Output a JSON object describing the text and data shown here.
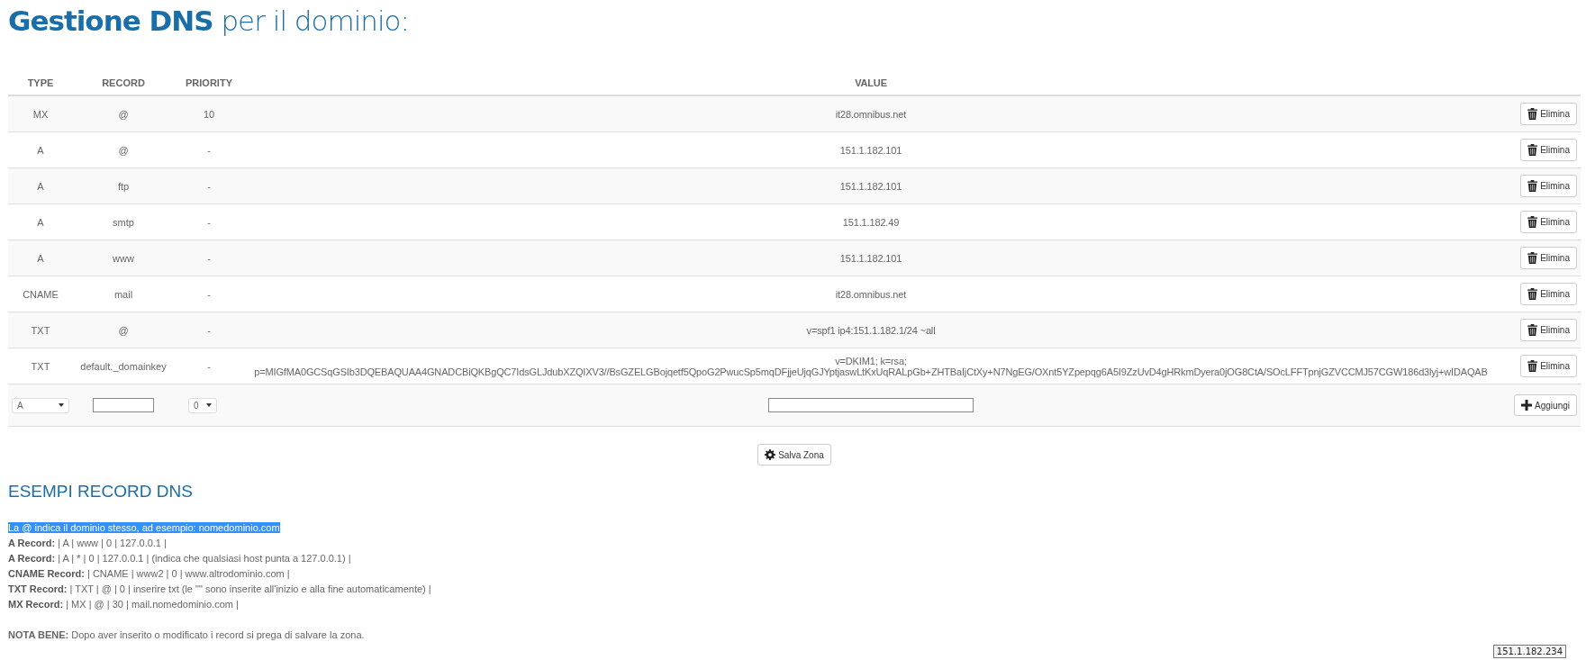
{
  "title": {
    "strong": "Gestione DNS",
    "rest": "per il dominio:"
  },
  "table": {
    "columns": [
      "TYPE",
      "RECORD",
      "PRIORITY",
      "VALUE"
    ],
    "rows": [
      {
        "type": "MX",
        "record": "@",
        "priority": "10",
        "value": "it28.omnibus.net",
        "action": "Elimina"
      },
      {
        "type": "A",
        "record": "@",
        "priority": "-",
        "value": "151.1.182.101",
        "action": "Elimina"
      },
      {
        "type": "A",
        "record": "ftp",
        "priority": "-",
        "value": "151.1.182.101",
        "action": "Elimina"
      },
      {
        "type": "A",
        "record": "smtp",
        "priority": "-",
        "value": "151.1.182.49",
        "action": "Elimina"
      },
      {
        "type": "A",
        "record": "www",
        "priority": "-",
        "value": "151.1.182.101",
        "action": "Elimina"
      },
      {
        "type": "CNAME",
        "record": "mail",
        "priority": "-",
        "value": "it28.omnibus.net",
        "action": "Elimina"
      },
      {
        "type": "TXT",
        "record": "@",
        "priority": "-",
        "value": "v=spf1 ip4:151.1.182.1/24 ~all",
        "action": "Elimina"
      },
      {
        "type": "TXT",
        "record": "default._domainkey",
        "priority": "-",
        "value": "v=DKIM1; k=rsa; p=MIGfMA0GCSqGSIb3DQEBAQUAA4GNADCBiQKBgQC7IdsGLJdubXZQIXV3//BsGZELGBojqetf5QpoG2PwucSp5mqDFjjeUjqGJYptjaswLtKxUqRALpGb+ZHTBaIjCtXy+N7NgEG/OXnt5YZpepqg6A5I9ZzUvD4gHRkmDyera0jOG8CtA/SOcLFFTpnjGZVCCMJ57CGW186d3lyj+wIDAQAB",
        "action": "Elimina"
      }
    ],
    "new_row": {
      "type_select": "A",
      "priority_select": "0",
      "add_button": "Aggiungi"
    }
  },
  "save_button": "Salva Zona",
  "examples": {
    "heading": "ESEMPI RECORD DNS",
    "intro": {
      "text": "La @ indica il dominio stesso, ad esempio: nomedominio.com",
      "highlighted": true
    },
    "lines": [
      {
        "label": "A Record:",
        "text": "| A | www | 0 | 127.0.0.1 |"
      },
      {
        "label": "A Record:",
        "text": "| A | * | 0 | 127.0.0.1 | (indica che qualsiasi host punta a 127.0.0.1) |"
      },
      {
        "label": "CNAME Record:",
        "text": "| CNAME | www2 | 0 | www.altrodominio.com |"
      },
      {
        "label": "TXT Record:",
        "text": "| TXT | @ | 0 | inserire txt (le \"\" sono inserite all'inizio e alla fine automaticamente) |"
      },
      {
        "label": "MX Record:",
        "text": "| MX | @ | 30 | mail.nomedominio.com |"
      }
    ],
    "note": "**NOTA BENE:** Dopo aver inserito o modificato i record si prega di salvare la zona."
  },
  "tooltip": "151.1.182.234"
}
